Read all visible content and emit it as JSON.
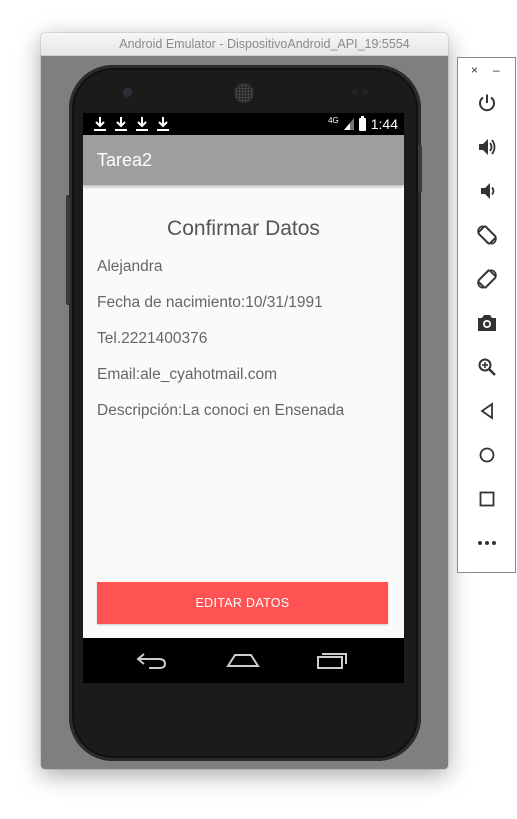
{
  "window": {
    "title": "Android Emulator - DispositivoAndroid_API_19:5554"
  },
  "status_bar": {
    "network": "4G",
    "time": "1:44"
  },
  "app": {
    "title": "Tarea2"
  },
  "confirm": {
    "heading": "Confirmar Datos",
    "name": "Alejandra",
    "birth_date": "Fecha de nacimiento:10/31/1991",
    "phone": "Tel.2221400376",
    "email": "Email:ale_cyahotmail.com",
    "description": "Descripción:La conoci en Ensenada",
    "edit_button": "EDITAR DATOS"
  },
  "toolbar": {
    "close": "×",
    "minimize": "–",
    "icons": [
      "power-icon",
      "volume-up-icon",
      "volume-down-icon",
      "rotate-left-icon",
      "rotate-right-icon",
      "camera-icon",
      "zoom-icon",
      "back-icon",
      "home-icon",
      "overview-icon",
      "more-icon"
    ]
  },
  "colors": {
    "app_bar": "#9e9e9e",
    "accent_button": "#ff5252",
    "emulator_bg": "#7f7f7f"
  }
}
